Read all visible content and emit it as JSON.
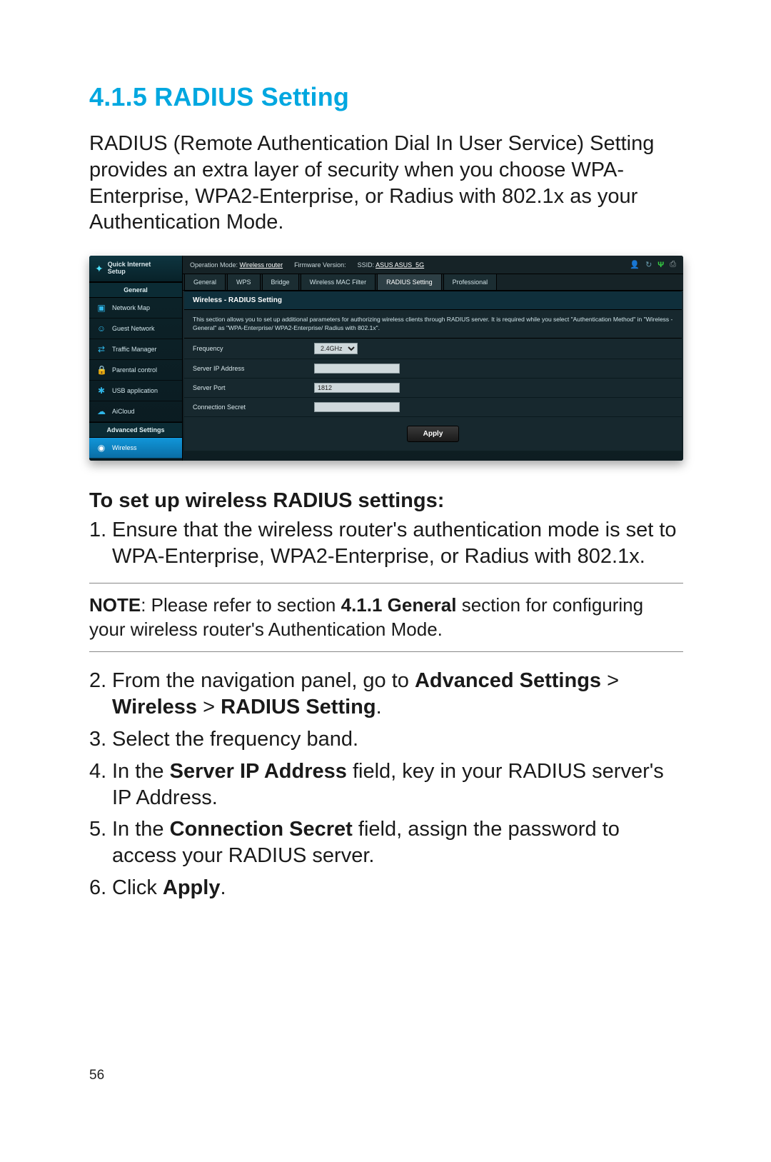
{
  "doc": {
    "section_number": "4.1.5",
    "section_title": "RADIUS Setting",
    "intro": "RADIUS (Remote Authentication Dial In User Service) Setting provides an extra layer of security when you choose WPA-Enterprise, WPA2-Enterprise, or Radius with 802.1x as your Authentication Mode.",
    "steps_heading": "To set up wireless RADIUS settings:",
    "note_prefix": "NOTE",
    "note_body_1": ":  Please refer to section ",
    "note_bold": "4.1.1 General",
    "note_body_2": " section for configuring your wireless router's Authentication Mode.",
    "steps": {
      "s1": "Ensure that the wireless router's authentication mode is set to WPA-Enterprise, WPA2-Enterprise, or Radius with 802.1x.",
      "s2a": "From the navigation panel, go to ",
      "s2b": "Advanced Settings",
      "s2c": " > ",
      "s2d": "Wireless",
      "s2e": " > ",
      "s2f": "RADIUS Setting",
      "s2g": ".",
      "s3": "Select the frequency band.",
      "s4a": "In the ",
      "s4b": "Server IP Address",
      "s4c": " field, key in your RADIUS server's IP Address.",
      "s5a": "In the ",
      "s5b": "Connection Secret",
      "s5c": " field, assign the password to access your RADIUS server.",
      "s6a": "Click ",
      "s6b": "Apply",
      "s6c": "."
    },
    "page_number": "56"
  },
  "ui": {
    "qis_line1": "Quick Internet",
    "qis_line2": "Setup",
    "section_general": "General",
    "section_advanced": "Advanced Settings",
    "nav": {
      "network_map": "Network Map",
      "guest": "Guest Network",
      "traffic": "Traffic Manager",
      "parental": "Parental control",
      "usb": "USB application",
      "aicloud": "AiCloud",
      "wireless": "Wireless"
    },
    "top": {
      "op_label": "Operation Mode: ",
      "op_value": "Wireless router",
      "fw_label": "Firmware Version:",
      "ssid_label": "SSID: ",
      "ssid_value": "ASUS  ASUS_5G"
    },
    "tabs": {
      "general": "General",
      "wps": "WPS",
      "bridge": "Bridge",
      "mac": "Wireless MAC Filter",
      "radius": "RADIUS Setting",
      "pro": "Professional"
    },
    "panel_title": "Wireless - RADIUS Setting",
    "panel_desc": "This section allows you to set up additional parameters for authorizing wireless clients through RADIUS server. It is required while you select \"Authentication Method\" in \"Wireless - General\" as \"WPA-Enterprise/ WPA2-Enterprise/ Radius with 802.1x\".",
    "form": {
      "frequency_label": "Frequency",
      "frequency_value": "2.4GHz",
      "server_ip_label": "Server IP Address",
      "server_ip_value": "",
      "server_port_label": "Server Port",
      "server_port_value": "1812",
      "secret_label": "Connection Secret",
      "secret_value": ""
    },
    "apply": "Apply"
  }
}
